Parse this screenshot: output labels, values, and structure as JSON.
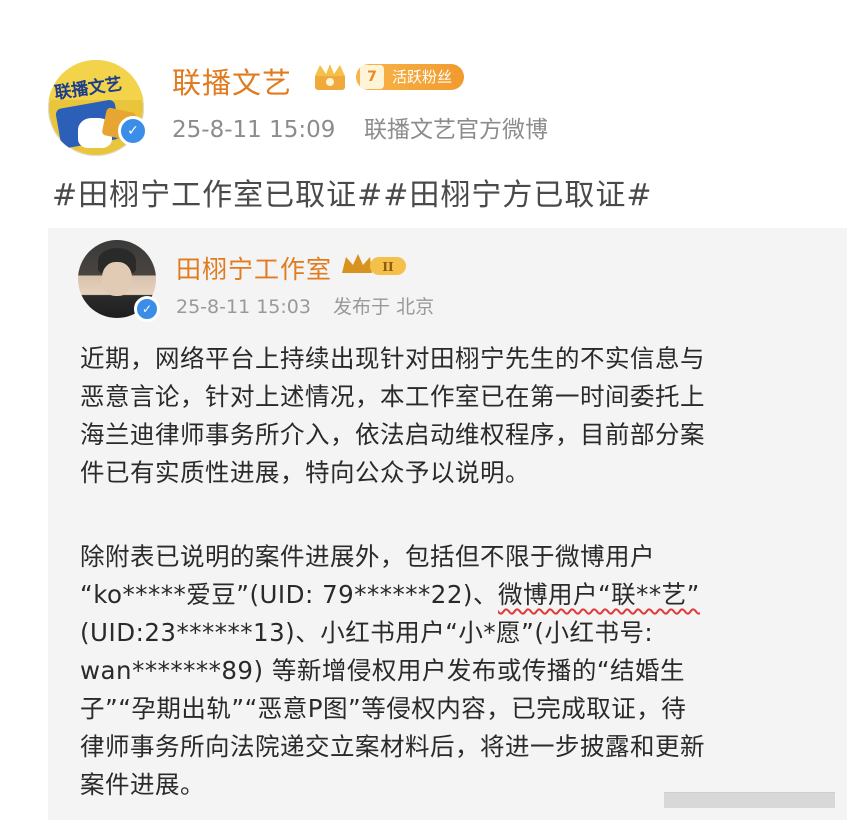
{
  "outer_post": {
    "author_name": "联播文艺",
    "fan_level": "7",
    "fan_badge_label": "活跃粉丝",
    "timestamp": "25-8-11 15:09",
    "source": "联播文艺官方微博",
    "hashtags": "#田栩宁工作室已取证##田栩宁方已取证#"
  },
  "quoted_post": {
    "author_name": "田栩宁工作室",
    "vip_level": "II",
    "timestamp": "25-8-11 15:03",
    "location": "发布于 北京",
    "paragraph1": [
      "近期，网络平台上持续出现针对田栩宁先生的不实信息与",
      "恶意言论，针对上述情况，本工作室已在第一时间委托上",
      "海兰迪律师事务所介入，依法启动维权程序，目前部分案",
      "件已有实质性进展，特向公众予以说明。"
    ],
    "paragraph2": {
      "line1": "除附表已说明的案件进展外，包括但不限于微博用户",
      "line2_before": "“ko*****爱豆”(UID: 79******22)、",
      "line2_highlight": "微博用户“联**艺”",
      "line3": "(UID:23******13)、小红书用户“小*愿”(小红书号:",
      "line4": "wan*******89) 等新增侵权用户发布或传播的“结婚生",
      "line5": "子”“孕期出轨”“恶意P图”等侵权内容，已完成取证，待",
      "line6": "律师事务所向法院递交立案材料后，将进一步披露和更新",
      "line7": "案件进展。"
    }
  },
  "colors": {
    "accent_name": "#e07b1f",
    "meta_gray": "#8c8c8c",
    "verified_blue": "#3b8ee8",
    "underline_red": "#e03a3a"
  }
}
